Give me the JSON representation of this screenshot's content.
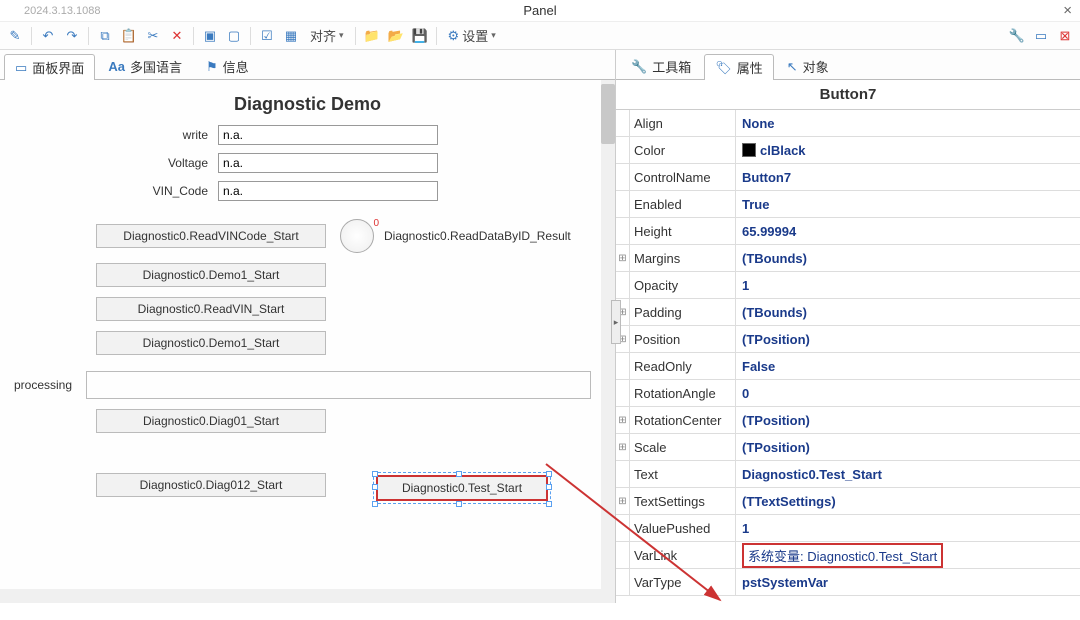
{
  "window": {
    "version": "2024.3.13.1088",
    "title": "Panel",
    "close": "×"
  },
  "toolbar": {
    "align": "对齐",
    "settings": "设置"
  },
  "leftTabs": [
    {
      "icon": "▭",
      "label": "面板界面"
    },
    {
      "icon": "Aa",
      "label": "多国语言"
    },
    {
      "icon": "⚑",
      "label": "信息"
    }
  ],
  "rightTabs": [
    {
      "icon": "🔧",
      "label": "工具箱"
    },
    {
      "icon": "🏷",
      "label": "属性"
    },
    {
      "icon": "↖",
      "label": "对象"
    }
  ],
  "diag": {
    "title": "Diagnostic Demo",
    "fields": [
      {
        "label": "write",
        "value": "n.a."
      },
      {
        "label": "Voltage",
        "value": "n.a."
      },
      {
        "label": "VIN_Code",
        "value": "n.a."
      }
    ],
    "btnReadVIN": "Diagnostic0.ReadVINCode_Start",
    "gaugeZero": "0",
    "gaugeLabel": "Diagnostic0.ReadDataByID_Result",
    "btnDemo1a": "Diagnostic0.Demo1_Start",
    "btnReadVIN2": "Diagnostic0.ReadVIN_Start",
    "btnDemo1b": "Diagnostic0.Demo1_Start",
    "processing": "processing",
    "btnDiag01": "Diagnostic0.Diag01_Start",
    "btnDiag012": "Diagnostic0.Diag012_Start",
    "btnTest": "Diagnostic0.Test_Start"
  },
  "propsTitle": "Button7",
  "props": [
    {
      "exp": "",
      "key": "Align",
      "val": "None"
    },
    {
      "exp": "",
      "key": "Color",
      "val": "clBlack",
      "chip": true
    },
    {
      "exp": "",
      "key": "ControlName",
      "val": "Button7"
    },
    {
      "exp": "",
      "key": "Enabled",
      "val": "True"
    },
    {
      "exp": "",
      "key": "Height",
      "val": "65.99994"
    },
    {
      "exp": "⊞",
      "key": "Margins",
      "val": "(TBounds)"
    },
    {
      "exp": "",
      "key": "Opacity",
      "val": "1"
    },
    {
      "exp": "⊞",
      "key": "Padding",
      "val": "(TBounds)"
    },
    {
      "exp": "⊞",
      "key": "Position",
      "val": "(TPosition)"
    },
    {
      "exp": "",
      "key": "ReadOnly",
      "val": "False"
    },
    {
      "exp": "",
      "key": "RotationAngle",
      "val": "0"
    },
    {
      "exp": "⊞",
      "key": "RotationCenter",
      "val": "(TPosition)"
    },
    {
      "exp": "⊞",
      "key": "Scale",
      "val": "(TPosition)"
    },
    {
      "exp": "",
      "key": "Text",
      "val": "Diagnostic0.Test_Start"
    },
    {
      "exp": "⊞",
      "key": "TextSettings",
      "val": "(TTextSettings)"
    },
    {
      "exp": "",
      "key": "ValuePushed",
      "val": "1"
    },
    {
      "exp": "",
      "key": "VarLink",
      "val": "系统变量: Diagnostic0.Test_Start",
      "hl": true
    },
    {
      "exp": "",
      "key": "VarType",
      "val": "pstSystemVar"
    }
  ]
}
